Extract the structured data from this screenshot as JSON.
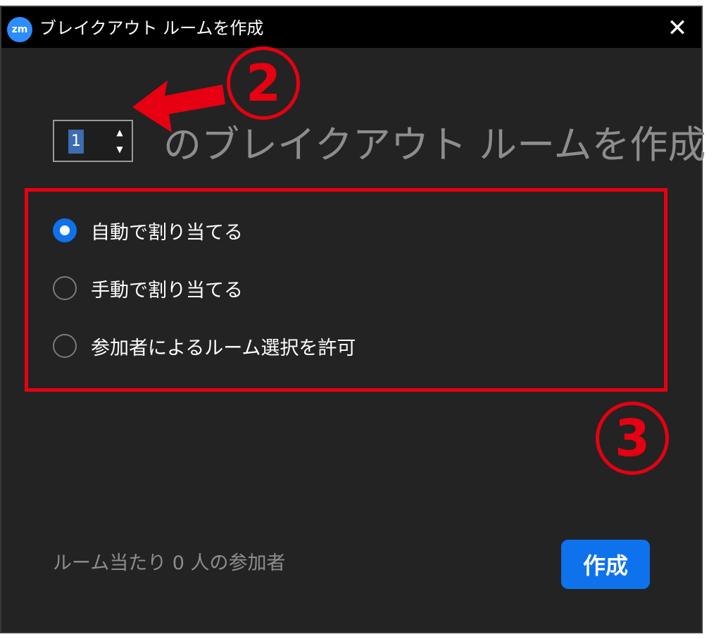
{
  "window": {
    "title": "ブレイクアウト ルームを作成",
    "app_icon_text": "zm",
    "close_glyph": "✕"
  },
  "spinner": {
    "value": "1",
    "up_glyph": "▲",
    "down_glyph": "▼"
  },
  "heading": "のブレイクアウト ルームを作成",
  "options": [
    {
      "label": "自動で割り当てる",
      "selected": true
    },
    {
      "label": "手動で割り当てる",
      "selected": false
    },
    {
      "label": "参加者によるルーム選択を許可",
      "selected": false
    }
  ],
  "annotations": {
    "marker_2": "2",
    "marker_3": "3",
    "color": "#e60012"
  },
  "footer": {
    "participants_text": "ルーム当たり 0 人の参加者",
    "create_label": "作成"
  },
  "colors": {
    "accent": "#0e72ed",
    "titlebar": "#000000",
    "background": "#232323"
  }
}
